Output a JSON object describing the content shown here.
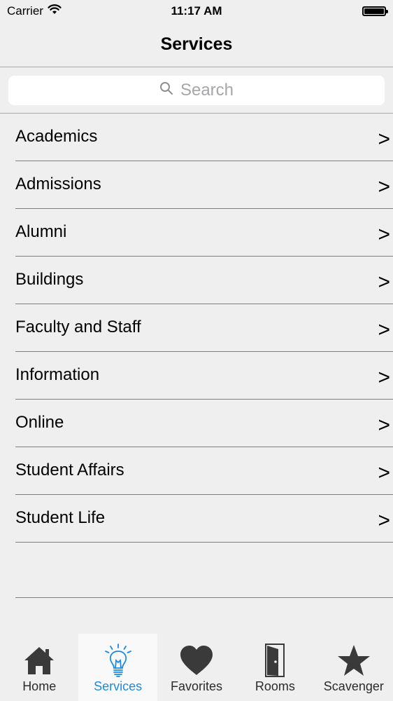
{
  "status_bar": {
    "carrier": "Carrier",
    "time": "11:17 AM"
  },
  "nav": {
    "title": "Services"
  },
  "search": {
    "placeholder": "Search"
  },
  "list": {
    "chevron": ">",
    "items": [
      {
        "label": "Academics"
      },
      {
        "label": "Admissions"
      },
      {
        "label": "Alumni"
      },
      {
        "label": "Buildings"
      },
      {
        "label": "Faculty and Staff"
      },
      {
        "label": "Information"
      },
      {
        "label": "Online"
      },
      {
        "label": "Student Affairs"
      },
      {
        "label": "Student Life"
      }
    ]
  },
  "tab_bar": {
    "active": "Services",
    "tabs": [
      {
        "label": "Home",
        "icon": "home-icon"
      },
      {
        "label": "Services",
        "icon": "lightbulb-icon"
      },
      {
        "label": "Favorites",
        "icon": "heart-icon"
      },
      {
        "label": "Rooms",
        "icon": "door-icon"
      },
      {
        "label": "Scavenger",
        "icon": "star-icon"
      }
    ]
  },
  "colors": {
    "background": "#efefef",
    "accent": "#1a8ae6",
    "active_tab_bg": "#f9f9f9",
    "separator": "#7f7f7f",
    "tab_icon": "#3a3a3a"
  }
}
